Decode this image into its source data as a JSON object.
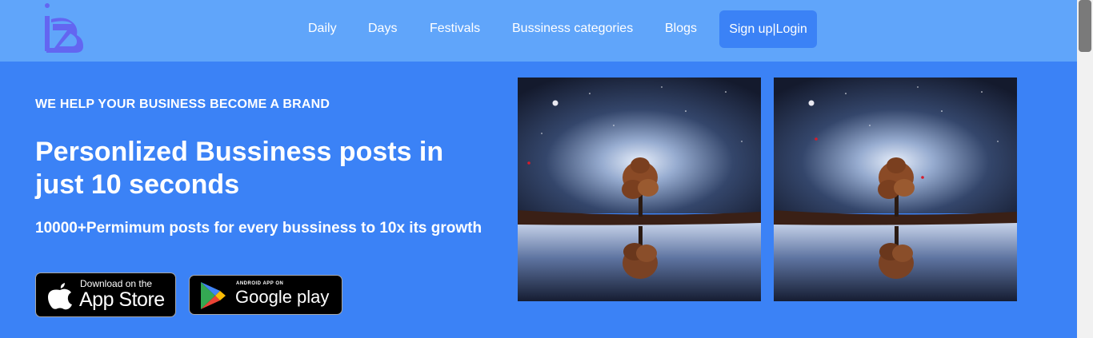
{
  "nav": {
    "links": [
      {
        "label": "Daily"
      },
      {
        "label": "Days"
      },
      {
        "label": "Festivals"
      },
      {
        "label": "Bussiness categories"
      },
      {
        "label": "Blogs"
      }
    ],
    "signup_label": "Sign up|Login"
  },
  "hero": {
    "tagline": "WE HELP YOUR BUSINESS BECOME A BRAND",
    "headline": "Personlized Bussiness posts in just 10 seconds",
    "subline": "10000+Permimum posts for every bussiness to 10x its growth",
    "app_store": {
      "small": "Download on the",
      "big": "App Store"
    },
    "google_play": {
      "small": "ANDROID APP ON",
      "big": "Google play"
    }
  },
  "colors": {
    "navbar": "#60a5fa",
    "hero": "#3b82f6",
    "signup_button": "#3b82f6",
    "logo": "#6366f1"
  },
  "icons": {
    "logo": "iz-logo",
    "apple": "apple-icon",
    "google_play": "google-play-icon"
  }
}
